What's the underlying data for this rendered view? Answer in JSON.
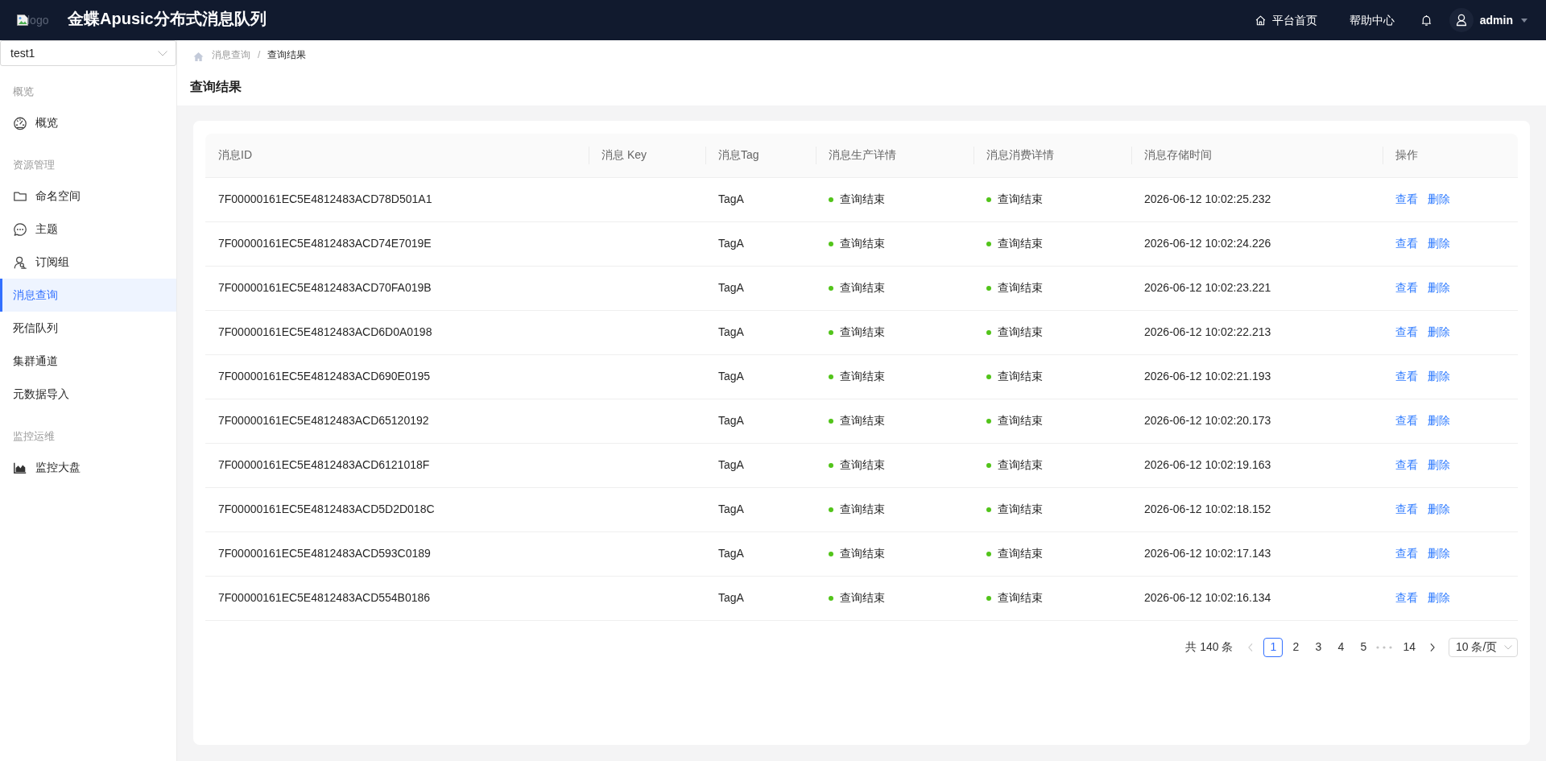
{
  "header": {
    "logo": {
      "alt": "logo"
    },
    "title": "金蝶Apusic分布式消息队列",
    "nav": [
      {
        "label": "平台首页",
        "kind": "icon"
      },
      {
        "label": "帮助中心",
        "kind": "text"
      }
    ],
    "user": {
      "name": "admin"
    }
  },
  "sidebar": {
    "cluster_select": {
      "value": "test1"
    },
    "sections": [
      {
        "label": "概览",
        "items": [
          {
            "label": "概览",
            "kind": "icon",
            "selected": false
          }
        ]
      },
      {
        "label": "资源管理",
        "items": [
          {
            "label": "命名空间",
            "kind": "icon",
            "selected": false
          },
          {
            "label": "主题",
            "kind": "icon",
            "selected": false
          },
          {
            "label": "订阅组",
            "kind": "icon",
            "selected": false
          },
          {
            "label": "消息查询",
            "kind": "text",
            "selected": true
          },
          {
            "label": "死信队列",
            "kind": "text",
            "selected": false
          },
          {
            "label": "集群通道",
            "kind": "text",
            "selected": false
          },
          {
            "label": "元数据导入",
            "kind": "text",
            "selected": false
          }
        ]
      },
      {
        "label": "监控运维",
        "items": [
          {
            "label": "监控大盘",
            "kind": "icon",
            "selected": false
          }
        ]
      }
    ]
  },
  "breadcrumb": {
    "separator": "/",
    "items": [
      {
        "label": "消息查询"
      },
      {
        "label": "查询结果"
      }
    ]
  },
  "page_title": "查询结果",
  "table": {
    "columns": [
      "消息ID",
      "消息 Key",
      "消息Tag",
      "消息生产详情",
      "消息消费详情",
      "消息存储时间",
      "操作"
    ],
    "rows": [
      {
        "message_id": "7F00000161EC5E4812483ACD78D501A1",
        "tag": "TagA",
        "producer_status": "查询结束",
        "consumer_status": "查询结束",
        "stored_at": "2026-06-12 10:02:25.232",
        "actions": [
          "查看",
          "删除"
        ]
      },
      {
        "message_id": "7F00000161EC5E4812483ACD74E7019E",
        "tag": "TagA",
        "producer_status": "查询结束",
        "consumer_status": "查询结束",
        "stored_at": "2026-06-12 10:02:24.226",
        "actions": [
          "查看",
          "删除"
        ]
      },
      {
        "message_id": "7F00000161EC5E4812483ACD70FA019B",
        "tag": "TagA",
        "producer_status": "查询结束",
        "consumer_status": "查询结束",
        "stored_at": "2026-06-12 10:02:23.221",
        "actions": [
          "查看",
          "删除"
        ]
      },
      {
        "message_id": "7F00000161EC5E4812483ACD6D0A0198",
        "tag": "TagA",
        "producer_status": "查询结束",
        "consumer_status": "查询结束",
        "stored_at": "2026-06-12 10:02:22.213",
        "actions": [
          "查看",
          "删除"
        ]
      },
      {
        "message_id": "7F00000161EC5E4812483ACD690E0195",
        "tag": "TagA",
        "producer_status": "查询结束",
        "consumer_status": "查询结束",
        "stored_at": "2026-06-12 10:02:21.193",
        "actions": [
          "查看",
          "删除"
        ]
      },
      {
        "message_id": "7F00000161EC5E4812483ACD65120192",
        "tag": "TagA",
        "producer_status": "查询结束",
        "consumer_status": "查询结束",
        "stored_at": "2026-06-12 10:02:20.173",
        "actions": [
          "查看",
          "删除"
        ]
      },
      {
        "message_id": "7F00000161EC5E4812483ACD6121018F",
        "tag": "TagA",
        "producer_status": "查询结束",
        "consumer_status": "查询结束",
        "stored_at": "2026-06-12 10:02:19.163",
        "actions": [
          "查看",
          "删除"
        ]
      },
      {
        "message_id": "7F00000161EC5E4812483ACD5D2D018C",
        "tag": "TagA",
        "producer_status": "查询结束",
        "consumer_status": "查询结束",
        "stored_at": "2026-06-12 10:02:18.152",
        "actions": [
          "查看",
          "删除"
        ]
      },
      {
        "message_id": "7F00000161EC5E4812483ACD593C0189",
        "tag": "TagA",
        "producer_status": "查询结束",
        "consumer_status": "查询结束",
        "stored_at": "2026-06-12 10:02:17.143",
        "actions": [
          "查看",
          "删除"
        ]
      },
      {
        "message_id": "7F00000161EC5E4812483ACD554B0186",
        "tag": "TagA",
        "producer_status": "查询结束",
        "consumer_status": "查询结束",
        "stored_at": "2026-06-12 10:02:16.134",
        "actions": [
          "查看",
          "删除"
        ]
      }
    ]
  },
  "pagination": {
    "total": "共 140 条",
    "prev": {
      "disabled": true
    },
    "pages": [
      {
        "kind": "page",
        "label": "1",
        "selected": true
      },
      {
        "kind": "page",
        "label": "2",
        "selected": false
      },
      {
        "kind": "page",
        "label": "3",
        "selected": false
      },
      {
        "kind": "page",
        "label": "4",
        "selected": false
      },
      {
        "kind": "page",
        "label": "5",
        "selected": false
      },
      {
        "kind": "ellipsis",
        "selected": false
      },
      {
        "kind": "page",
        "label": "14",
        "selected": false
      }
    ],
    "next": {
      "disabled": false
    },
    "page_size": "10 条/页"
  }
}
